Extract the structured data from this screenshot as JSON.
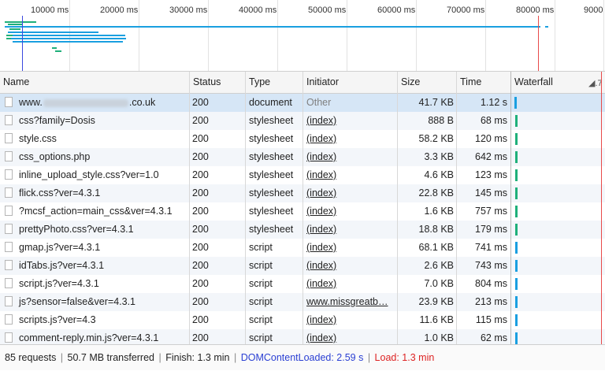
{
  "overview": {
    "ticks": [
      "10000 ms",
      "20000 ms",
      "30000 ms",
      "40000 ms",
      "50000 ms",
      "60000 ms",
      "70000 ms",
      "80000 ms",
      "9000"
    ]
  },
  "columns": {
    "name": "Name",
    "status": "Status",
    "type": "Type",
    "initiator": "Initiator",
    "size": "Size",
    "time": "Time",
    "waterfall": "Waterfall"
  },
  "rows": [
    {
      "name_prefix": "www.",
      "name_suffix": ".co.uk",
      "status": "200",
      "type": "document",
      "initiator": "Other",
      "size": "41.7 KB",
      "time": "1.12 s"
    },
    {
      "name": "css?family=Dosis",
      "status": "200",
      "type": "stylesheet",
      "initiator": "(index)",
      "size": "888 B",
      "time": "68 ms"
    },
    {
      "name": "style.css",
      "status": "200",
      "type": "stylesheet",
      "initiator": "(index)",
      "size": "58.2 KB",
      "time": "120 ms"
    },
    {
      "name": "css_options.php",
      "status": "200",
      "type": "stylesheet",
      "initiator": "(index)",
      "size": "3.3 KB",
      "time": "642 ms"
    },
    {
      "name": "inline_upload_style.css?ver=1.0",
      "status": "200",
      "type": "stylesheet",
      "initiator": "(index)",
      "size": "4.6 KB",
      "time": "123 ms"
    },
    {
      "name": "flick.css?ver=4.3.1",
      "status": "200",
      "type": "stylesheet",
      "initiator": "(index)",
      "size": "22.8 KB",
      "time": "145 ms"
    },
    {
      "name": "?mcsf_action=main_css&ver=4.3.1",
      "status": "200",
      "type": "stylesheet",
      "initiator": "(index)",
      "size": "1.6 KB",
      "time": "757 ms"
    },
    {
      "name": "prettyPhoto.css?ver=4.3.1",
      "status": "200",
      "type": "stylesheet",
      "initiator": "(index)",
      "size": "18.8 KB",
      "time": "179 ms"
    },
    {
      "name": "gmap.js?ver=4.3.1",
      "status": "200",
      "type": "script",
      "initiator": "(index)",
      "size": "68.1 KB",
      "time": "741 ms"
    },
    {
      "name": "idTabs.js?ver=4.3.1",
      "status": "200",
      "type": "script",
      "initiator": "(index)",
      "size": "2.6 KB",
      "time": "743 ms"
    },
    {
      "name": "script.js?ver=4.3.1",
      "status": "200",
      "type": "script",
      "initiator": "(index)",
      "size": "7.0 KB",
      "time": "804 ms"
    },
    {
      "name": "js?sensor=false&ver=4.3.1",
      "status": "200",
      "type": "script",
      "initiator": "www.missgreatb…",
      "size": "23.9 KB",
      "time": "213 ms"
    },
    {
      "name": "scripts.js?ver=4.3",
      "status": "200",
      "type": "script",
      "initiator": "(index)",
      "size": "11.6 KB",
      "time": "115 ms"
    },
    {
      "name": "comment-reply.min.js?ver=4.3.1",
      "status": "200",
      "type": "script",
      "initiator": "(index)",
      "size": "1.0 KB",
      "time": "62 ms"
    }
  ],
  "status_bar": {
    "requests": "85 requests",
    "transferred": "50.7 MB transferred",
    "finish": "Finish: 1.3 min",
    "dom_content_loaded": "DOMContentLoaded: 2.59 s",
    "load": "Load: 1.3 min"
  },
  "colors": {
    "document": "#1a9fe0",
    "stylesheet": "#1fb07a",
    "script": "#1a9fe0",
    "dom_line": "#3b49df",
    "load_line": "#e84a4a"
  }
}
